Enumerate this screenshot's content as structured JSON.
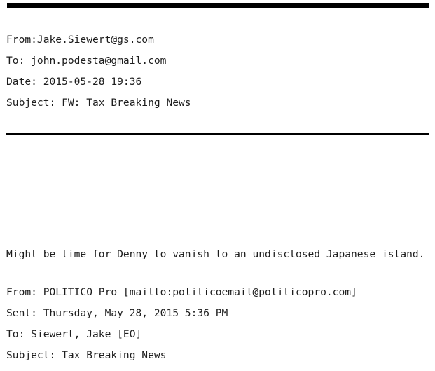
{
  "document": {
    "type": "plain-text-email",
    "top_rule_color": "#000000",
    "separator_color": "#000000",
    "text_color": "#1d1d1d",
    "background_color": "#ffffff"
  },
  "headers": {
    "from": "From:Jake.Siewert@gs.com",
    "to": "To: john.podesta@gmail.com",
    "date": "Date: 2015-05-28 19:36",
    "subject": "Subject: FW: Tax Breaking News"
  },
  "body": {
    "line1": "Might be time for Denny to vanish to an undisclosed Japanese island."
  },
  "forwarded_headers": {
    "from": "From: POLITICO Pro [mailto:politicoemail@politicopro.com]",
    "sent": "Sent: Thursday, May 28, 2015 5:36 PM",
    "to": "To: Siewert, Jake [EO]",
    "subject": "Subject: Tax Breaking News"
  }
}
